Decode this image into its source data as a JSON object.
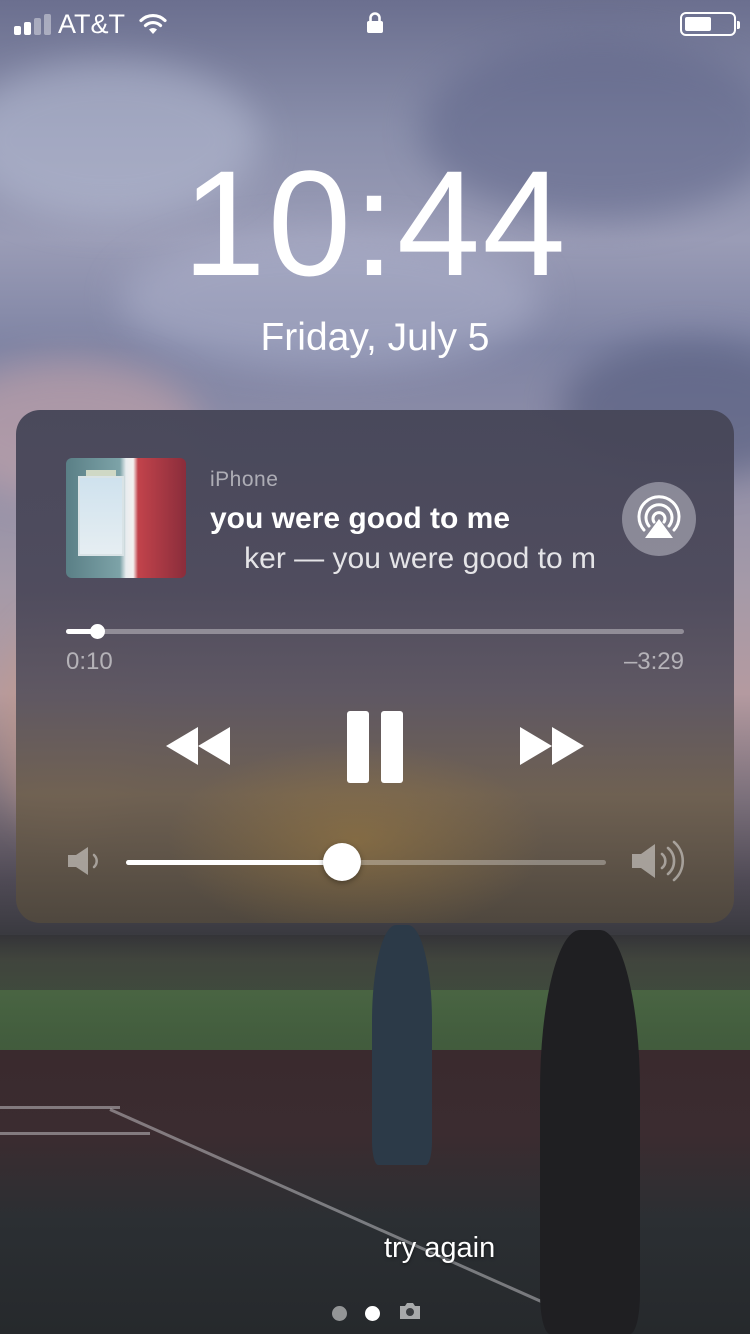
{
  "status_bar": {
    "carrier": "AT&T",
    "signal_bars": 4,
    "signal_bars_active": 2,
    "wifi_icon": "wifi-icon",
    "lock_icon": "lock-icon",
    "battery_level": 0.62
  },
  "lockscreen": {
    "time": "10:44",
    "date": "Friday, July 5"
  },
  "now_playing": {
    "source": "iPhone",
    "song_title": "you were good to me",
    "artist_line": "ker — you were good to m",
    "elapsed": "0:10",
    "remaining": "–3:29",
    "progress": 0.05,
    "volume": 0.45,
    "airplay_icon": "airplay-icon",
    "controls": {
      "rewind_icon": "rewind-icon",
      "pause_icon": "pause-icon",
      "fast_forward_icon": "fast-forward-icon"
    }
  },
  "caption": "try again",
  "page_indicator": {
    "pages": 2,
    "active_index": 1,
    "camera_icon": "camera-icon"
  }
}
